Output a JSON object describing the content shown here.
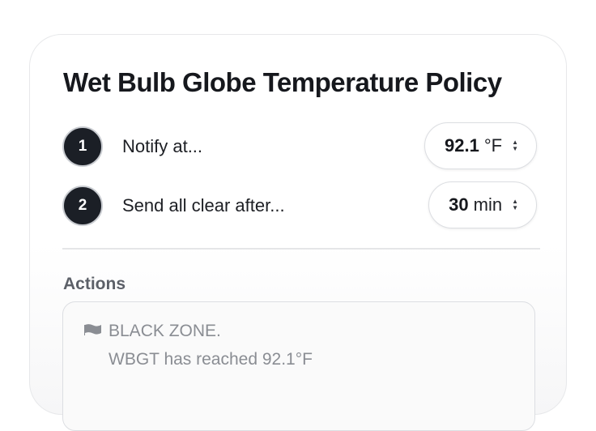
{
  "policy": {
    "title": "Wet Bulb Globe Temperature Policy",
    "steps": [
      {
        "number": "1",
        "label": "Notify at...",
        "value": "92.1",
        "unit": "°F"
      },
      {
        "number": "2",
        "label": "Send all clear after...",
        "value": "30",
        "unit": "min"
      }
    ],
    "actions_label": "Actions",
    "action": {
      "icon": "flag-icon",
      "title": "BLACK ZONE.",
      "message": "WBGT has reached 92.1°F"
    }
  },
  "colors": {
    "badge": "#1b1f26",
    "text": "#16181d",
    "muted": "#8a8d93",
    "flag": "#8a8d93"
  }
}
